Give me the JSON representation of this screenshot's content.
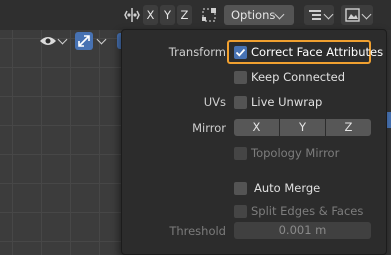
{
  "header": {
    "axis_buttons": [
      "X",
      "Y",
      "Z"
    ],
    "options_label": "Options"
  },
  "popover": {
    "transform_label": "Transform",
    "correct_face_attributes": "Correct Face Attributes",
    "keep_connected": "Keep Connected",
    "uvs_label": "UVs",
    "live_unwrap": "Live Unwrap",
    "mirror_label": "Mirror",
    "mirror_axes": [
      "X",
      "Y",
      "Z"
    ],
    "topology_mirror": "Topology Mirror",
    "auto_merge": "Auto Merge",
    "split_edges_faces": "Split Edges & Faces",
    "threshold_label": "Threshold",
    "threshold_value": "0.001 m"
  },
  "colors": {
    "accent": "#4772b3",
    "highlight": "#f0a030"
  }
}
